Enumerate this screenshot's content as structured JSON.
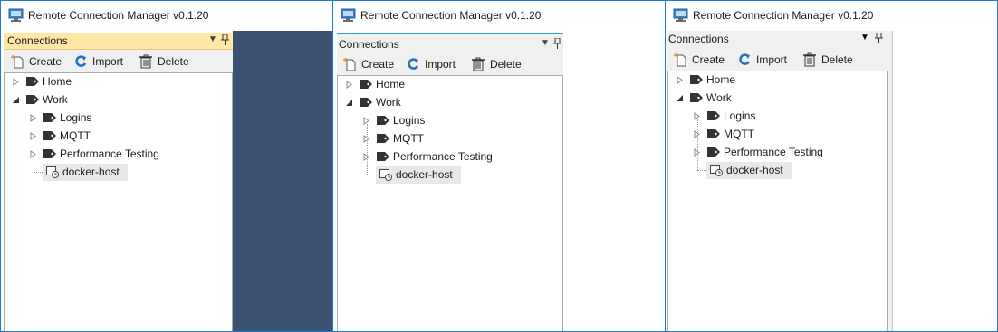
{
  "app": {
    "title": "Remote Connection Manager v0.1.20"
  },
  "panel": {
    "title": "Connections"
  },
  "toolbar": {
    "create": "Create",
    "import": "Import",
    "delete": "Delete"
  },
  "tree": {
    "home": "Home",
    "work": "Work",
    "logins": "Logins",
    "mqtt": "MQTT",
    "perf": "Performance Testing",
    "docker": "docker-host"
  },
  "colors": {
    "window_border": "#1e7bd3",
    "active_header": "#ffe7a6",
    "accent_line": "#2e9bdb",
    "dark_dock": "#3c5272"
  }
}
